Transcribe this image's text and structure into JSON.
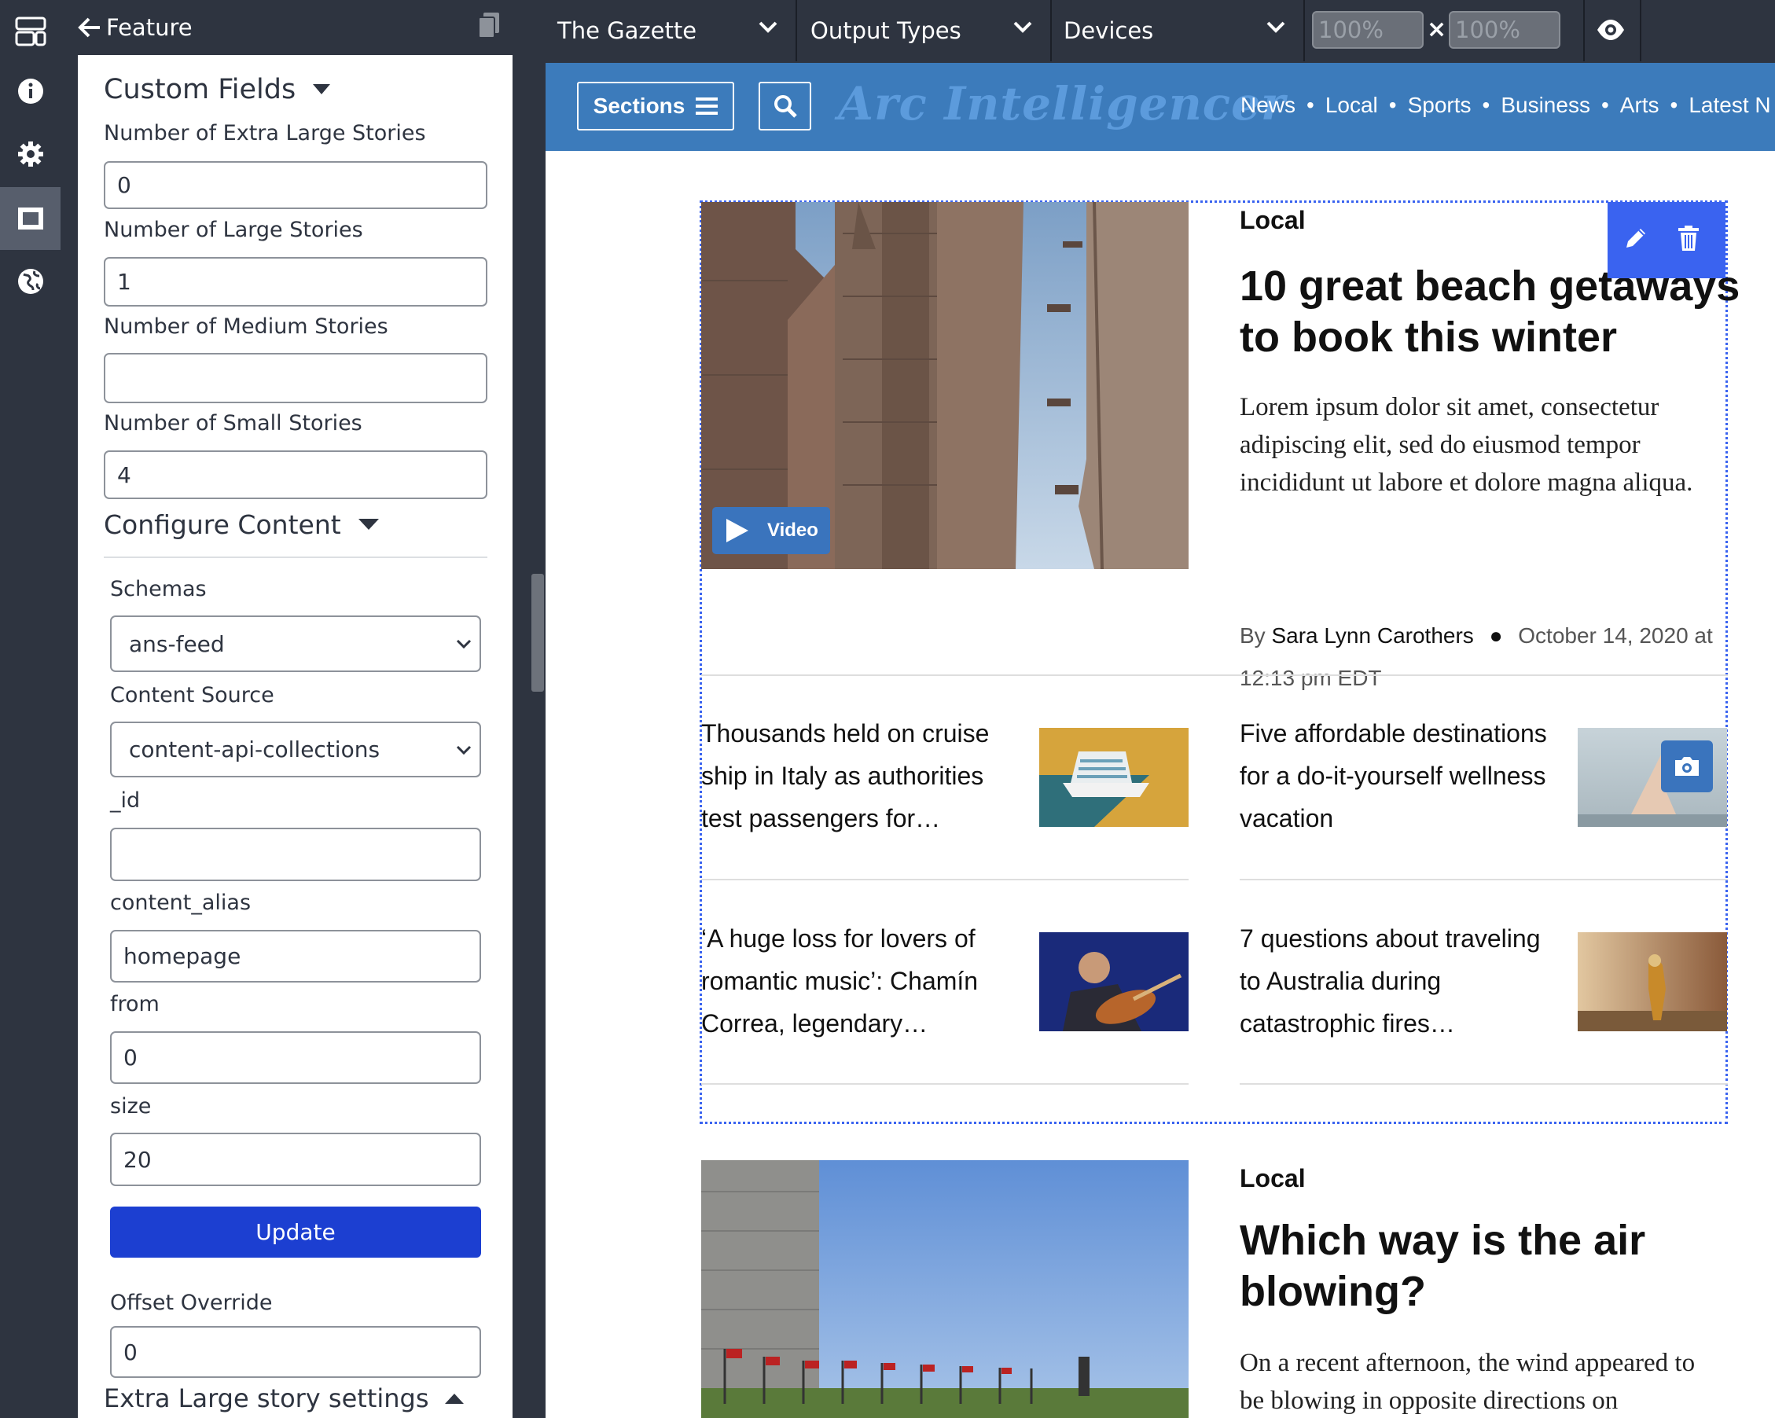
{
  "panel": {
    "back_label": "Feature",
    "custom_fields_heading": "Custom Fields",
    "fields": {
      "xl_label": "Number of Extra Large Stories",
      "xl_value": "0",
      "lg_label": "Number of Large Stories",
      "lg_value": "1",
      "md_label": "Number of Medium Stories",
      "md_value": "",
      "sm_label": "Number of Small Stories",
      "sm_value": "4"
    },
    "configure_heading": "Configure Content",
    "schemas_label": "Schemas",
    "schemas_value": "ans-feed",
    "source_label": "Content Source",
    "source_value": "content-api-collections",
    "id_label": "_id",
    "id_value": "",
    "alias_label": "content_alias",
    "alias_value": "homepage",
    "from_label": "from",
    "from_value": "0",
    "size_label": "size",
    "size_value": "20",
    "update_label": "Update",
    "offset_label": "Offset Override",
    "offset_value": "0",
    "xl_settings_heading": "Extra Large story settings"
  },
  "topbar": {
    "site": "The Gazette",
    "output_types": "Output Types",
    "devices": "Devices",
    "width": "100%",
    "height": "100%",
    "times": "×"
  },
  "site": {
    "sections_label": "Sections",
    "logo": "Arc Intelligencer",
    "nav": [
      "News",
      "Local",
      "Sports",
      "Business",
      "Arts",
      "Latest N"
    ],
    "nav_sep": "•",
    "lead": {
      "kicker": "Local",
      "headline": "10 great beach getaways to book this winter",
      "description": "Lorem ipsum dolor sit amet, consectetur adipiscing elit, sed do eiusmod tempor incididunt ut labore et dolore magna aliqua.",
      "by": "By",
      "author": "Sara Lynn Carothers",
      "date": "October 14, 2020 at 12:13 pm EDT",
      "video_label": "Video"
    },
    "small_stories": [
      "Thousands held on cruise ship in Italy as authorities test passengers for…",
      "Five affordable destinations for a do-it-yourself wellness vacation",
      "‘A huge loss for lovers of romantic music’: Chamín Correa, legendary…",
      "7 questions about traveling to Australia during catastrophic fires…"
    ],
    "second": {
      "kicker": "Local",
      "headline": "Which way is the air blowing?",
      "description": "On a recent afternoon, the wind appeared to be blowing in opposite directions on"
    }
  },
  "colors": {
    "chrome": "#2e3440",
    "nav_blue": "#3c7bbb",
    "update_blue": "#1c3fd1",
    "edit_blue": "#3a63f0"
  }
}
